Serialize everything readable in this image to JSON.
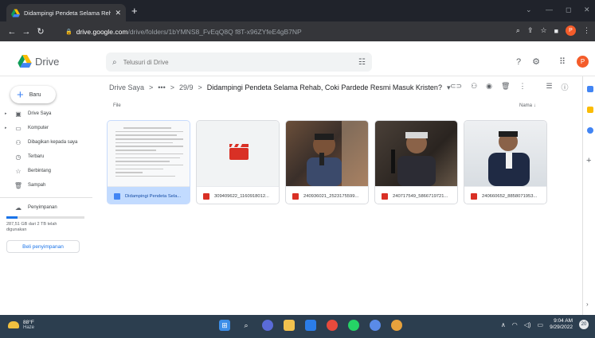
{
  "browser": {
    "tab_title": "Didampingi Pendeta Selama Reh",
    "url_host": "drive.google.com",
    "url_path": "/drive/folders/1bYMNS8_FvEqQ8Q f8T-x96ZYfeE4gB7NP",
    "new_tab_glyph": "+",
    "close_glyph": "✕",
    "profile_initial": "P"
  },
  "drive": {
    "product_name": "Drive",
    "search_placeholder": "Telusuri di Drive",
    "avatar_initial": "P"
  },
  "sidebar": {
    "new_label": "Baru",
    "items": [
      {
        "label": "Drive Saya",
        "icon": "my-drive-icon"
      },
      {
        "label": "Komputer",
        "icon": "computer-icon"
      },
      {
        "label": "Dibagikan kepada saya",
        "icon": "shared-icon"
      },
      {
        "label": "Terbaru",
        "icon": "recent-icon"
      },
      {
        "label": "Berbintang",
        "icon": "star-icon"
      },
      {
        "label": "Sampah",
        "icon": "trash-icon"
      },
      {
        "label": "Penyimpanan",
        "icon": "cloud-icon"
      }
    ],
    "storage_text": "287,51 GB dari 2 TB telah digunakan",
    "storage_fraction": 0.14,
    "buy_label": "Beli penyimpanan"
  },
  "breadcrumb": {
    "root": "Drive Saya",
    "ellipsis": "•••",
    "parent": "29/9",
    "current": "Didampingi Pendeta Selama Rehab, Coki Pardede Resmi Masuk Kristen?",
    "separator": ">",
    "dropdown": "▾"
  },
  "list": {
    "section_label": "File",
    "sort_label": "Nama",
    "sort_arrow": "↓"
  },
  "files": [
    {
      "name": "Didampingi Pendeta Sela...",
      "kind": "doc"
    },
    {
      "name": "309409622_1160918012...",
      "kind": "video"
    },
    {
      "name": "240936021_2523175599...",
      "kind": "image"
    },
    {
      "name": "240717549_5866719721...",
      "kind": "image"
    },
    {
      "name": "240660652_8858071953...",
      "kind": "image"
    }
  ],
  "taskbar": {
    "temp": "88°F",
    "weather": "Haze",
    "time": "9:04 AM",
    "date": "9/29/2022",
    "notification_count": "20"
  },
  "colors": {
    "accent": "#1a73e8",
    "video_red": "#d93025",
    "selected_bg": "#c2dbff"
  }
}
